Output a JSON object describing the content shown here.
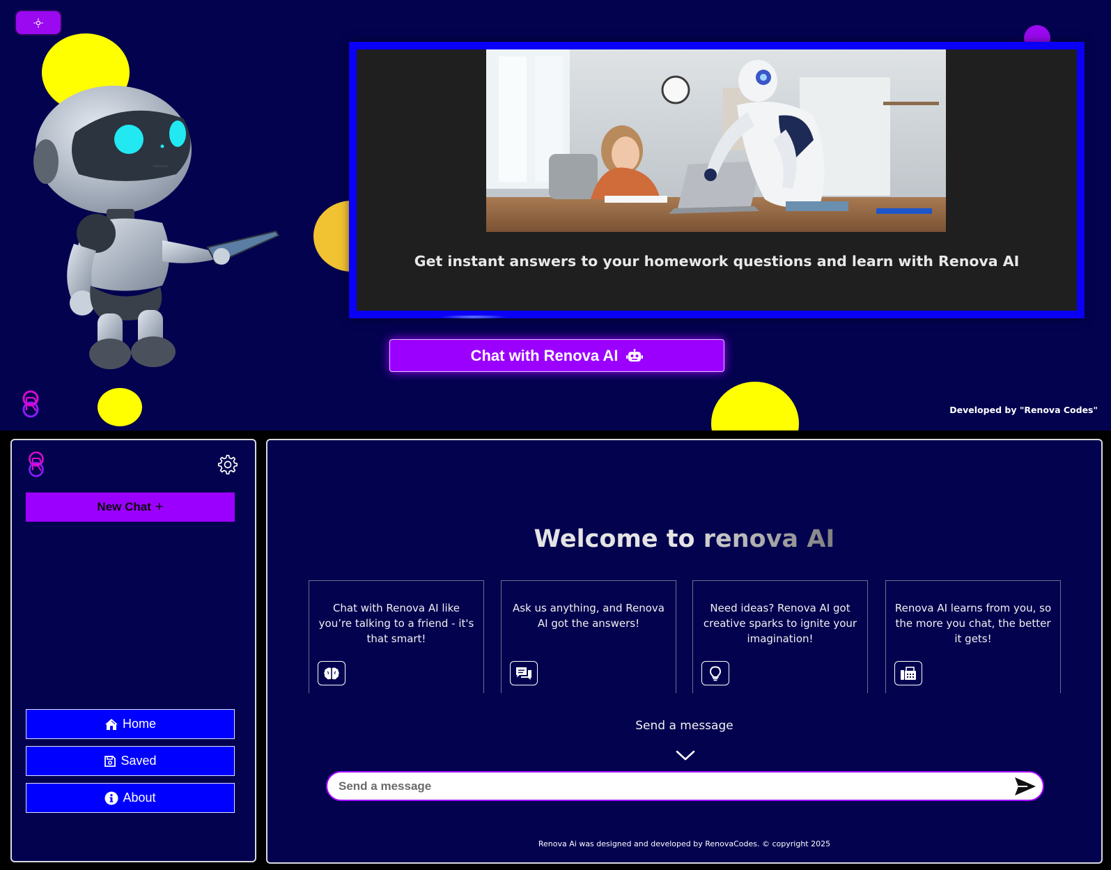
{
  "hero": {
    "caption": "Get instant answers to your homework questions and learn with Renova AI",
    "cta_label": "Chat with Renova AI",
    "developed_by": "Developed by \"Renova Codes\""
  },
  "sidebar": {
    "new_chat_label": "New Chat",
    "new_chat_symbol": "+",
    "nav": [
      {
        "label": "Home",
        "icon": "home-icon"
      },
      {
        "label": "Saved",
        "icon": "save-icon"
      },
      {
        "label": "About",
        "icon": "info-icon"
      }
    ]
  },
  "main": {
    "welcome_part1": "Welcome to ",
    "welcome_part2": "renova AI",
    "cards": [
      {
        "text": "Chat with Renova AI like you’re talking to a friend - it's that smart!",
        "icon": "brain-icon"
      },
      {
        "text": "Ask us anything, and Renova AI got the answers!",
        "icon": "chat-bubbles-icon"
      },
      {
        "text": "Need ideas? Renova AI got creative sparks to ignite your imagination!",
        "icon": "lightbulb-icon"
      },
      {
        "text": "Renova AI learns from you, so the more you chat, the better it gets!",
        "icon": "fax-icon"
      }
    ],
    "send_label": "Send a message",
    "input_placeholder": "Send a message",
    "footer": "Renova Ai was designed and developed by RenovaCodes. © copyright 2025"
  },
  "colors": {
    "background": "#03024f",
    "accent_purple": "#9b00ff",
    "accent_blue": "#0000ff",
    "yellow": "#ffff00"
  }
}
